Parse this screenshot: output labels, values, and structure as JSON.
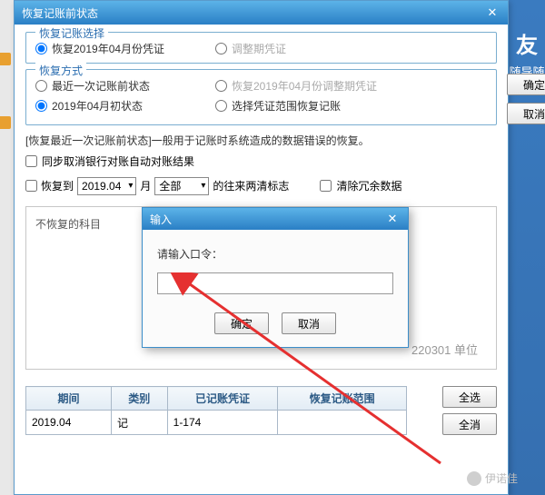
{
  "bg": {
    "brand_ch": "友",
    "brand_sub": "随导随"
  },
  "window": {
    "title": "恢复记账前状态"
  },
  "group1": {
    "legend": "恢复记账选择",
    "opt1": "恢复2019年04月份凭证",
    "opt2": "调整期凭证"
  },
  "group2": {
    "legend": "恢复方式",
    "opt1": "最近一次记账前状态",
    "opt2": "恢复2019年04月份调整期凭证",
    "opt3": "2019年04月初状态",
    "opt4": "选择凭证范围恢复记账"
  },
  "buttons": {
    "ok": "确定",
    "cancel": "取消",
    "all": "全选",
    "none": "全消"
  },
  "hint": "[恢复最近一次记账前状态]一般用于记账时系统造成的数据错误的恢复。",
  "ck1": "同步取消银行对账自动对账结果",
  "line": {
    "pre": "恢复到",
    "period": "2019.04",
    "month_lbl": "月",
    "scope": "全部",
    "suf": "的往来两清标志"
  },
  "ck2": "清除冗余数据",
  "sub": {
    "label": "不恢复的科目",
    "obscured": "220301 单位"
  },
  "table": {
    "h1": "期间",
    "h2": "类别",
    "h3": "已记账凭证",
    "h4": "恢复记账范围",
    "r": {
      "c1": "2019.04",
      "c2": "记",
      "c3": "1-174",
      "c4": ""
    }
  },
  "modal": {
    "title": "输入",
    "label": "请输入口令：",
    "ok": "确定",
    "cancel": "取消"
  },
  "wm": "伊诺佳"
}
